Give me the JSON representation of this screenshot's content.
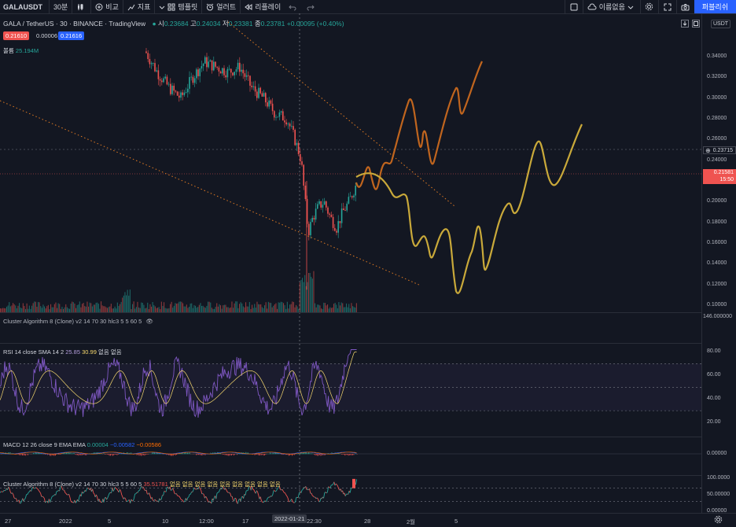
{
  "toolbar": {
    "symbol": "GALAUSDT",
    "interval": "30분",
    "compare": "비교",
    "indicators": "지표",
    "templates": "템플릿",
    "alerts": "얼러트",
    "replay": "리플레이",
    "unnamed": "이름없음",
    "publish": "퍼블리쉬"
  },
  "legend": {
    "title": "GALA / TetherUS · 30 · BINANCE · TradingView",
    "open_label": "시",
    "open": "0.23684",
    "high_label": "고",
    "high": "0.24034",
    "low_label": "저",
    "low": "0.23381",
    "close_label": "종",
    "close": "0.23781",
    "change": "+0.00095 (+0.40%)",
    "bid": "0.21610",
    "spread": "0.00006",
    "ask": "0.21616",
    "volume_label": "볼륨",
    "volume": "25.194M"
  },
  "price_axis": {
    "currency": "USDT",
    "ticks": [
      "0.34000",
      "0.32000",
      "0.30000",
      "0.28000",
      "0.26000",
      "0.24000",
      "0.22000",
      "0.20000",
      "0.18000",
      "0.16000",
      "0.14000",
      "0.12000",
      "0.10000"
    ],
    "current_marker": "0.23715",
    "last_price": "0.21581",
    "countdown": "15:50"
  },
  "panes": {
    "cluster1": {
      "label": "Cluster Algorithm 8 (Clone) v2 14 70 30 hlc3 5 5 60 5",
      "axis": "146.000000"
    },
    "rsi": {
      "label_prefix": "RSI 14 close SMA 14 2",
      "v1": "25.85",
      "v2": "30.99",
      "v3": "없음 없음",
      "ticks": [
        "80.00",
        "60.00",
        "40.00",
        "20.00"
      ]
    },
    "macd": {
      "label_prefix": "MACD 12 26 close 9 EMA EMA",
      "v1": "0.00004",
      "v2": "−0.00582",
      "v3": "−0.00586",
      "ticks": [
        "0.00000"
      ]
    },
    "cluster2": {
      "label_prefix": "Cluster Algorithm 8 (Clone) v2 14 70 30 hlc3 5 5 60 5",
      "v1": "35.51781",
      "v2": "없음 없음 없음 없음 없음 없음 없음 없음 없음",
      "ticks": [
        "100.0000",
        "50.00000",
        "0.00000"
      ]
    }
  },
  "time_axis": {
    "labels": [
      "27",
      "2022",
      "5",
      "10",
      "12:00",
      "17",
      "22:30",
      "28",
      "2월",
      "5"
    ],
    "crosshair_date": "2022-01-21"
  },
  "colors": {
    "background": "#131722",
    "up": "#26a69a",
    "down": "#ef5350",
    "projection_orange": "#c0651e",
    "projection_yellow": "#c9a93a",
    "trendline": "#e07a22",
    "rsi_line": "#7e57c2",
    "accent": "#2962ff"
  }
}
